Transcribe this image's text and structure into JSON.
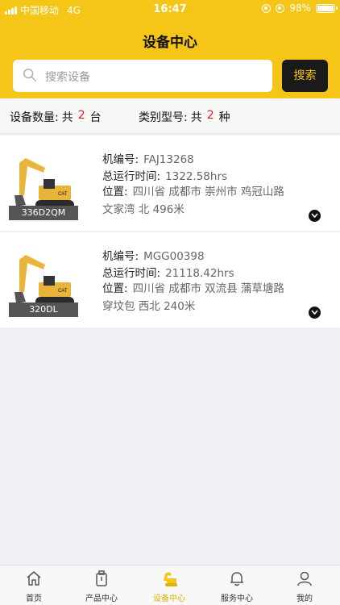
{
  "status_bar": {
    "carrier": "中国移动",
    "network": "4G",
    "time": "16:47",
    "battery": "98%",
    "battery_level": 0.98
  },
  "header": {
    "title": "设备中心"
  },
  "search": {
    "placeholder": "搜索设备",
    "button_label": "搜索"
  },
  "stats": {
    "count_label": "设备数量:",
    "count_prefix": "共",
    "count_value": "2",
    "count_unit": "台",
    "type_label": "类别型号:",
    "type_prefix": "共",
    "type_value": "2",
    "type_unit": "种"
  },
  "devices": [
    {
      "model": "336D2QM",
      "id_label": "机编号:",
      "id_value": "FAJ13268",
      "hours_label": "总运行时间:",
      "hours_value": "1322.58hrs",
      "location_label": "位置:",
      "location_line1": "四川省 成都市 崇州市 鸡冠山路",
      "location_line2": "文家湾 北 496米"
    },
    {
      "model": "320DL",
      "id_label": "机编号:",
      "id_value": "MGG00398",
      "hours_label": "总运行时间:",
      "hours_value": "21118.42hrs",
      "location_label": "位置:",
      "location_line1": "四川省 成都市 双流县 蒲草塘路",
      "location_line2": "穿坟包 西北 240米"
    }
  ],
  "tabbar": [
    {
      "label": "首页",
      "icon": "home-icon"
    },
    {
      "label": "产品中心",
      "icon": "product-icon"
    },
    {
      "label": "设备中心",
      "icon": "excavator-icon",
      "active": true
    },
    {
      "label": "服务中心",
      "icon": "bell-icon"
    },
    {
      "label": "我的",
      "icon": "user-icon"
    }
  ],
  "colors": {
    "brand_yellow": "#f5c518",
    "accent_red": "#e02020",
    "dark": "#1a1a1a"
  }
}
